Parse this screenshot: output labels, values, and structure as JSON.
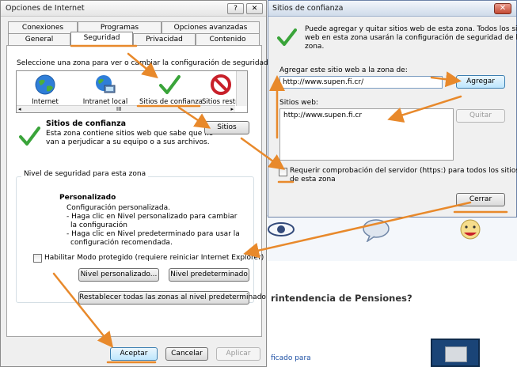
{
  "background": {
    "heading": "rintendencia de Pensiones?",
    "link": "ficado para"
  },
  "internet_options": {
    "title": "Opciones de Internet",
    "title_buttons": {
      "help": "?",
      "close": "✕"
    },
    "tabs_top": [
      "Conexiones",
      "Programas",
      "Opciones avanzadas"
    ],
    "tabs_bottom": [
      "General",
      "Seguridad",
      "Privacidad",
      "Contenido"
    ],
    "active_tab": "Seguridad",
    "select_zone_text": "Seleccione una zona para ver o cambiar la configuración de seguridad.",
    "zones": [
      {
        "label": "Internet",
        "icon": "globe-icon"
      },
      {
        "label": "Intranet local",
        "icon": "intranet-globe-icon"
      },
      {
        "label": "Sitios de confianza",
        "icon": "checkmark-icon"
      },
      {
        "label": "Sitios restri",
        "icon": "restricted-icon"
      }
    ],
    "zone_heading": "Sitios de confianza",
    "zone_description": [
      "Esta zona contiene sitios web que sabe que no",
      "van a perjudicar a su equipo o a sus archivos."
    ],
    "sites_button": "Sitios",
    "security_level_group": "Nivel de seguridad para esta zona",
    "custom_heading": "Personalizado",
    "custom_lines": [
      "Configuración personalizada.",
      "- Haga clic en Nivel personalizado para cambiar",
      "la configuración",
      "- Haga clic en Nivel predeterminado para usar la",
      "configuración recomendada."
    ],
    "protected_mode_label": "Habilitar Modo protegido (requiere reiniciar Internet Explorer)",
    "protected_mode_checked": false,
    "custom_level_button": "Nivel personalizado...",
    "default_level_button": "Nivel predeterminado",
    "reset_all_button": "Restablecer todas las zonas al nivel predeterminado",
    "accept_button": "Aceptar",
    "cancel_button": "Cancelar",
    "apply_button": "Aplicar",
    "scroll_mark": "III"
  },
  "trusted_sites": {
    "title": "Sitios de confianza",
    "close_glyph": "✕",
    "intro": [
      "Puede agregar y quitar sitios web de esta zona. Todos los sitios",
      "web en esta zona usarán la configuración de seguridad de la",
      "zona."
    ],
    "add_label": "Agregar este sitio web a la zona de:",
    "add_value": "http://www.supen.fi.cr/",
    "add_button": "Agregar",
    "sites_label": "Sitios web:",
    "sites": [
      "http://www.supen.fi.cr"
    ],
    "remove_button": "Quitar",
    "require_https_label": [
      "Requerir comprobación del servidor (https:) para todos los sitios",
      "de esta zona"
    ],
    "require_https_checked": false,
    "close_button": "Cerrar"
  },
  "colors": {
    "annotation_arrow": "#e8892b",
    "check_green": "#3aa43a",
    "restricted_red": "#c8202a"
  }
}
